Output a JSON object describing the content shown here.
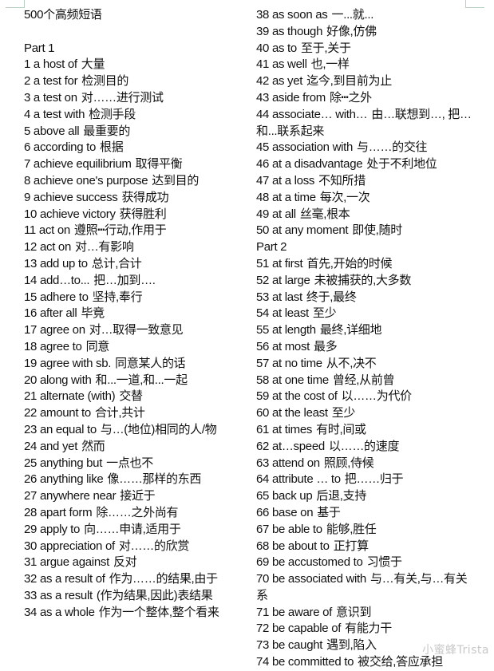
{
  "document": {
    "title": "500个高频短语",
    "watermark": "小蜜蜂Trista",
    "left_column": [
      {
        "type": "heading",
        "text": "Part 1"
      },
      {
        "type": "entry",
        "en": "1 a host of",
        "zh": "大量"
      },
      {
        "type": "entry",
        "en": "2 a test for",
        "zh": "检测目的"
      },
      {
        "type": "entry",
        "en": "3 a test on",
        "zh": "对……进行测试"
      },
      {
        "type": "entry",
        "en": "4 a test with",
        "zh": "检测手段"
      },
      {
        "type": "entry",
        "en": "5 above all",
        "zh": "最重要的"
      },
      {
        "type": "entry",
        "en": "6 according to",
        "zh": "根据"
      },
      {
        "type": "entry",
        "en": "7 achieve equilibrium",
        "zh": "取得平衡"
      },
      {
        "type": "entry",
        "en": "8 achieve one's purpose",
        "zh": "达到目的"
      },
      {
        "type": "entry",
        "en": "9 achieve success",
        "zh": "获得成功"
      },
      {
        "type": "entry",
        "en": "10 achieve victory",
        "zh": "获得胜利"
      },
      {
        "type": "entry",
        "en": "11 act on",
        "zh": "遵照┅行动,作用于"
      },
      {
        "type": "entry",
        "en": "12 act on",
        "zh": "对…有影响"
      },
      {
        "type": "entry",
        "en": "13 add up to",
        "zh": "总计,合计"
      },
      {
        "type": "entry",
        "en": "14 add…to...",
        "zh": "把…加到…."
      },
      {
        "type": "entry",
        "en": "15 adhere to",
        "zh": "坚持,奉行"
      },
      {
        "type": "entry",
        "en": "16 after all",
        "zh": "毕竟"
      },
      {
        "type": "entry",
        "en": "17 agree on",
        "zh": "对…取得一致意见"
      },
      {
        "type": "entry",
        "en": "18 agree to",
        "zh": "同意"
      },
      {
        "type": "entry",
        "en": "19 agree with sb.",
        "zh": "同意某人的话"
      },
      {
        "type": "entry",
        "en": "20 along with",
        "zh": "和...一道,和...一起"
      },
      {
        "type": "entry",
        "en": "21 alternate (with)",
        "zh": "交替"
      },
      {
        "type": "entry",
        "en": "22 amount to",
        "zh": "合计,共计"
      },
      {
        "type": "entry",
        "en": "23 an equal to",
        "zh": "与…(地位)相同的人/物",
        "wrap": true
      },
      {
        "type": "entry",
        "en": "24 and yet",
        "zh": "然而"
      },
      {
        "type": "entry",
        "en": "25 anything but",
        "zh": "一点也不"
      },
      {
        "type": "entry",
        "en": "26 anything like",
        "zh": "像……那样的东西"
      },
      {
        "type": "entry",
        "en": "27 anywhere near",
        "zh": "接近于"
      },
      {
        "type": "entry",
        "en": "28 apart form",
        "zh": "除……之外尚有"
      },
      {
        "type": "entry",
        "en": "29 apply to",
        "zh": "向……申请,适用于"
      },
      {
        "type": "entry",
        "en": "30 appreciation of",
        "zh": "对……的欣赏"
      },
      {
        "type": "entry",
        "en": "31 argue against",
        "zh": "反对"
      },
      {
        "type": "entry",
        "en": "32 as a result of",
        "zh": "作为……的结果,由于",
        "wrap": true
      },
      {
        "type": "entry",
        "en": "33 as a result",
        "zh": "(作为结果,因此)表结果"
      },
      {
        "type": "entry",
        "en": "34 as a whole",
        "zh": "作为一个整体,整个看来",
        "wrap": true
      }
    ],
    "right_column": [
      {
        "type": "entry",
        "en": "38 as soon as",
        "zh": "一...就..."
      },
      {
        "type": "entry",
        "en": "39 as though",
        "zh": "好像,仿佛"
      },
      {
        "type": "entry",
        "en": "40 as to",
        "zh": "至于,关于"
      },
      {
        "type": "entry",
        "en": "41 as well",
        "zh": "也,一样"
      },
      {
        "type": "entry",
        "en": "42 as yet",
        "zh": "迄今,到目前为止"
      },
      {
        "type": "entry",
        "en": "43 aside from",
        "zh": "除┅之外"
      },
      {
        "type": "entry",
        "en": "44 associate… with…",
        "zh": "由…联想到…, 把…和...联系起来",
        "wrap": true
      },
      {
        "type": "entry",
        "en": "45 association with",
        "zh": "与……的交往"
      },
      {
        "type": "entry",
        "en": "46 at a disadvantage",
        "zh": "处于不利地位"
      },
      {
        "type": "entry",
        "en": "47 at a loss",
        "zh": "不知所措"
      },
      {
        "type": "entry",
        "en": "48 at a time",
        "zh": "每次,一次"
      },
      {
        "type": "entry",
        "en": "49 at all",
        "zh": "丝毫,根本"
      },
      {
        "type": "entry",
        "en": "50 at any moment",
        "zh": "即使,随时"
      },
      {
        "type": "heading",
        "text": "Part 2"
      },
      {
        "type": "entry",
        "en": "51 at first",
        "zh": "首先,开始的时候"
      },
      {
        "type": "entry",
        "en": "52 at large",
        "zh": "未被捕获的,大多数"
      },
      {
        "type": "entry",
        "en": "53 at last",
        "zh": "终于,最终"
      },
      {
        "type": "entry",
        "en": "54 at least",
        "zh": "至少"
      },
      {
        "type": "entry",
        "en": "55 at length",
        "zh": "最终,详细地"
      },
      {
        "type": "entry",
        "en": "56 at most",
        "zh": "最多"
      },
      {
        "type": "entry",
        "en": "57 at no time",
        "zh": "从不,决不"
      },
      {
        "type": "entry",
        "en": "58 at one time",
        "zh": "曾经,从前曾"
      },
      {
        "type": "entry",
        "en": "59 at the cost of",
        "zh": "以……为代价"
      },
      {
        "type": "entry",
        "en": "60 at the least",
        "zh": "至少"
      },
      {
        "type": "entry",
        "en": "61 at times",
        "zh": "有时,间或"
      },
      {
        "type": "entry",
        "en": "62 at…speed",
        "zh": "以……的速度"
      },
      {
        "type": "entry",
        "en": "63 attend on",
        "zh": "照顾,侍候"
      },
      {
        "type": "entry",
        "en": "64 attribute … to",
        "zh": "把……归于"
      },
      {
        "type": "entry",
        "en": "65 back up",
        "zh": "后退,支持"
      },
      {
        "type": "entry",
        "en": "66 base on",
        "zh": "基于"
      },
      {
        "type": "entry",
        "en": "67 be able to",
        "zh": "能够,胜任"
      },
      {
        "type": "entry",
        "en": "68 be about to",
        "zh": "正打算"
      },
      {
        "type": "entry",
        "en": "69 be accustomed to",
        "zh": "习惯于"
      },
      {
        "type": "entry",
        "en": "70 be associated with",
        "zh": "与…有关,与…有关系",
        "wrap": true
      },
      {
        "type": "entry",
        "en": "71 be aware of",
        "zh": "意识到"
      },
      {
        "type": "entry",
        "en": "72 be capable of",
        "zh": "有能力干"
      },
      {
        "type": "entry",
        "en": "73 be caught",
        "zh": "遇到,陷入"
      },
      {
        "type": "entry",
        "en": "74 be committed to",
        "zh": "被交给,答应承担"
      }
    ]
  }
}
